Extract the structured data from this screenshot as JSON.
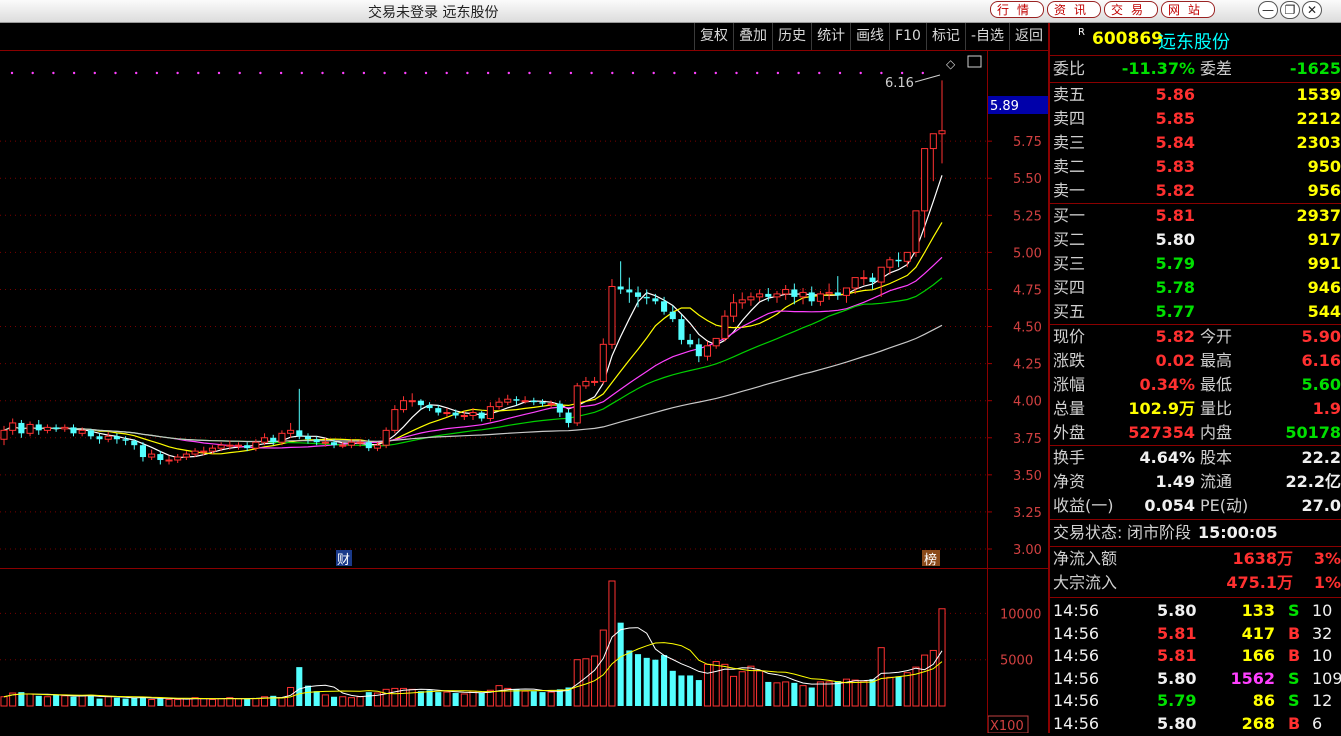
{
  "window": {
    "title": "交易未登录 远东股份",
    "top_buttons": [
      "行情",
      "资讯",
      "交易",
      "网站"
    ],
    "controls": [
      "—",
      "❐",
      "✕"
    ]
  },
  "toolbar": {
    "buttons": [
      "复权",
      "叠加",
      "历史",
      "统计",
      "画线",
      "F10",
      "标记",
      "-自选",
      "返回"
    ]
  },
  "chart": {
    "price_axis": [
      "5.75",
      "5.50",
      "5.25",
      "5.00",
      "4.75",
      "4.50",
      "4.25",
      "4.00",
      "3.75",
      "3.50",
      "3.25",
      "3.00"
    ],
    "current_price_label": "5.89",
    "high_annotation": "6.16",
    "marker_cai": "财",
    "marker_bang": "榜",
    "volume_axis": [
      "10000",
      "5000"
    ],
    "volume_unit": "X100",
    "colors": {
      "up": "#ff3232",
      "down": "#54ffff",
      "ma5": "#ffffff",
      "ma10": "#ffff00",
      "ma20": "#ff40ff",
      "ma30": "#00d000",
      "ma60": "#c8c8c8"
    }
  },
  "chart_data": {
    "type": "candlestick",
    "ylim": [
      3.0,
      6.25
    ],
    "volume_ylim": [
      0,
      13500
    ],
    "x": [
      1,
      2,
      3,
      4,
      5,
      6,
      7,
      8,
      9,
      10,
      11,
      12,
      13,
      14,
      15,
      16,
      17,
      18,
      19,
      20,
      21,
      22,
      23,
      24,
      25,
      26,
      27,
      28,
      29,
      30,
      31,
      32,
      33,
      34,
      35,
      36,
      37,
      38,
      39,
      40,
      41,
      42,
      43,
      44,
      45,
      46,
      47,
      48,
      49,
      50,
      51,
      52,
      53,
      54,
      55,
      56,
      57,
      58,
      59,
      60,
      61,
      62,
      63,
      64,
      65,
      66,
      67,
      68,
      69,
      70,
      71,
      72,
      73,
      74,
      75,
      76,
      77,
      78,
      79,
      80,
      81,
      82,
      83,
      84,
      85,
      86,
      87,
      88,
      89,
      90,
      91,
      92,
      93,
      94,
      95,
      96,
      97,
      98,
      99,
      100,
      101,
      102,
      103,
      104,
      105,
      106,
      107,
      108,
      109,
      110,
      111,
      112,
      113,
      114,
      115,
      116,
      117,
      118,
      119
    ],
    "open": [
      3.74,
      3.8,
      3.85,
      3.78,
      3.84,
      3.8,
      3.82,
      3.81,
      3.82,
      3.78,
      3.8,
      3.76,
      3.74,
      3.76,
      3.74,
      3.73,
      3.7,
      3.62,
      3.64,
      3.6,
      3.6,
      3.62,
      3.64,
      3.66,
      3.66,
      3.68,
      3.7,
      3.7,
      3.7,
      3.68,
      3.72,
      3.75,
      3.72,
      3.78,
      3.8,
      3.76,
      3.74,
      3.72,
      3.72,
      3.7,
      3.7,
      3.72,
      3.72,
      3.68,
      3.7,
      3.8,
      3.94,
      4.0,
      4.0,
      3.97,
      3.95,
      3.92,
      3.92,
      3.9,
      3.9,
      3.92,
      3.88,
      3.96,
      3.99,
      4.01,
      4.0,
      4.0,
      3.99,
      3.98,
      3.98,
      3.92,
      3.85,
      4.1,
      4.13,
      4.13,
      4.38,
      4.77,
      4.75,
      4.73,
      4.7,
      4.69,
      4.67,
      4.6,
      4.55,
      4.41,
      4.38,
      4.3,
      4.37,
      4.42,
      4.57,
      4.66,
      4.68,
      4.7,
      4.72,
      4.7,
      4.72,
      4.75,
      4.7,
      4.73,
      4.67,
      4.72,
      4.73,
      4.71,
      4.76,
      4.83,
      4.83,
      4.8,
      4.9,
      4.95,
      4.94,
      5.0,
      5.28,
      5.7,
      5.8
    ],
    "close": [
      3.8,
      3.85,
      3.78,
      3.84,
      3.8,
      3.82,
      3.81,
      3.82,
      3.78,
      3.8,
      3.76,
      3.74,
      3.76,
      3.74,
      3.73,
      3.7,
      3.62,
      3.64,
      3.6,
      3.6,
      3.62,
      3.64,
      3.66,
      3.66,
      3.68,
      3.7,
      3.7,
      3.7,
      3.68,
      3.72,
      3.75,
      3.72,
      3.78,
      3.8,
      3.76,
      3.74,
      3.72,
      3.72,
      3.7,
      3.7,
      3.72,
      3.72,
      3.68,
      3.7,
      3.8,
      3.94,
      4.0,
      4.0,
      3.97,
      3.95,
      3.92,
      3.92,
      3.9,
      3.9,
      3.92,
      3.88,
      3.96,
      3.99,
      4.01,
      4.0,
      4.0,
      3.99,
      3.98,
      3.98,
      3.92,
      3.85,
      4.1,
      4.13,
      4.13,
      4.38,
      4.77,
      4.75,
      4.73,
      4.7,
      4.69,
      4.67,
      4.6,
      4.55,
      4.41,
      4.38,
      4.3,
      4.37,
      4.42,
      4.57,
      4.66,
      4.68,
      4.7,
      4.72,
      4.7,
      4.72,
      4.75,
      4.7,
      4.73,
      4.67,
      4.72,
      4.73,
      4.71,
      4.76,
      4.83,
      4.83,
      4.8,
      4.9,
      4.95,
      4.94,
      5.0,
      5.28,
      5.7,
      5.8,
      5.82
    ],
    "high": [
      3.83,
      3.88,
      3.87,
      3.86,
      3.87,
      3.84,
      3.84,
      3.84,
      3.84,
      3.82,
      3.81,
      3.78,
      3.79,
      3.78,
      3.76,
      3.74,
      3.72,
      3.67,
      3.66,
      3.63,
      3.64,
      3.66,
      3.68,
      3.69,
      3.7,
      3.72,
      3.73,
      3.72,
      3.72,
      3.74,
      3.78,
      3.77,
      3.8,
      3.85,
      4.08,
      3.78,
      3.76,
      3.75,
      3.74,
      3.72,
      3.74,
      3.74,
      3.74,
      3.72,
      3.82,
      3.97,
      4.03,
      4.05,
      4.01,
      3.99,
      3.97,
      3.95,
      3.94,
      3.93,
      3.95,
      3.93,
      3.99,
      4.02,
      4.04,
      4.03,
      4.03,
      4.02,
      4.01,
      4.0,
      4.0,
      3.94,
      4.12,
      4.16,
      4.16,
      4.42,
      4.82,
      4.94,
      4.83,
      4.77,
      4.75,
      4.72,
      4.7,
      4.64,
      4.58,
      4.45,
      4.42,
      4.4,
      4.41,
      4.61,
      4.72,
      4.73,
      4.73,
      4.75,
      4.76,
      4.74,
      4.78,
      4.79,
      4.76,
      4.77,
      4.74,
      4.79,
      4.84,
      4.75,
      4.81,
      4.88,
      4.86,
      4.86,
      4.97,
      5.0,
      5.0,
      5.08,
      5.33,
      5.8,
      6.16
    ],
    "low": [
      3.7,
      3.77,
      3.75,
      3.76,
      3.77,
      3.78,
      3.79,
      3.79,
      3.76,
      3.76,
      3.74,
      3.71,
      3.72,
      3.71,
      3.7,
      3.67,
      3.59,
      3.6,
      3.57,
      3.57,
      3.58,
      3.6,
      3.62,
      3.63,
      3.64,
      3.66,
      3.67,
      3.67,
      3.66,
      3.66,
      3.7,
      3.7,
      3.7,
      3.75,
      3.74,
      3.71,
      3.7,
      3.69,
      3.68,
      3.68,
      3.68,
      3.69,
      3.66,
      3.66,
      3.68,
      3.78,
      3.92,
      3.96,
      3.94,
      3.93,
      3.9,
      3.89,
      3.88,
      3.87,
      3.87,
      3.86,
      3.86,
      3.94,
      3.97,
      3.97,
      3.98,
      3.97,
      3.96,
      3.95,
      3.89,
      3.82,
      3.83,
      4.08,
      4.1,
      4.11,
      4.35,
      4.72,
      4.66,
      4.63,
      4.65,
      4.65,
      4.58,
      4.53,
      4.38,
      4.36,
      4.26,
      4.27,
      4.35,
      4.4,
      4.53,
      4.62,
      4.64,
      4.67,
      4.67,
      4.66,
      4.68,
      4.65,
      4.65,
      4.64,
      4.64,
      4.68,
      4.68,
      4.66,
      4.72,
      4.78,
      4.75,
      4.7,
      4.85,
      4.9,
      4.9,
      4.97,
      5.1,
      5.48,
      5.6
    ],
    "volume": [
      1000,
      1400,
      1500,
      1300,
      1100,
      1000,
      1200,
      1100,
      1000,
      1100,
      1200,
      800,
      1000,
      900,
      800,
      900,
      1000,
      700,
      800,
      700,
      700,
      800,
      900,
      800,
      700,
      800,
      900,
      800,
      800,
      800,
      1000,
      1100,
      900,
      2000,
      4200,
      2200,
      1600,
      1200,
      1000,
      1000,
      900,
      1000,
      1500,
      1400,
      1800,
      1900,
      1900,
      1800,
      1600,
      1700,
      1500,
      1500,
      1400,
      1300,
      1600,
      1400,
      1700,
      2200,
      1900,
      1800,
      1600,
      1600,
      1500,
      1500,
      1800,
      2000,
      5000,
      5100,
      5400,
      8200,
      13500,
      9000,
      6000,
      5600,
      5200,
      5000,
      5500,
      3800,
      3300,
      3300,
      2800,
      4500,
      4800,
      4500,
      3200,
      3700,
      4300,
      3800,
      2600,
      2500,
      2600,
      2500,
      2200,
      2000,
      2600,
      2600,
      2700,
      2900,
      2800,
      2700,
      2900,
      6300,
      3100,
      3200,
      3600,
      4200,
      5500,
      6000,
      10500
    ],
    "ma_series": [
      "MA5",
      "MA10",
      "MA20",
      "MA30",
      "MA60"
    ]
  },
  "quote": {
    "code": "600869",
    "name": "远东股份",
    "weibi_label": "委比",
    "weibi_value": "-11.37%",
    "weicha_label": "委差",
    "weicha_value": "-1625",
    "sell": [
      {
        "label": "卖五",
        "price": "5.86",
        "vol": "1539"
      },
      {
        "label": "卖四",
        "price": "5.85",
        "vol": "2212"
      },
      {
        "label": "卖三",
        "price": "5.84",
        "vol": "2303"
      },
      {
        "label": "卖二",
        "price": "5.83",
        "vol": "950"
      },
      {
        "label": "卖一",
        "price": "5.82",
        "vol": "956"
      }
    ],
    "buy": [
      {
        "label": "买一",
        "price": "5.81",
        "vol": "2937"
      },
      {
        "label": "买二",
        "price": "5.80",
        "vol": "917"
      },
      {
        "label": "买三",
        "price": "5.79",
        "vol": "991"
      },
      {
        "label": "买四",
        "price": "5.78",
        "vol": "946"
      },
      {
        "label": "买五",
        "price": "5.77",
        "vol": "544"
      }
    ],
    "stats": [
      {
        "l1": "现价",
        "v1": "5.82",
        "l2": "今开",
        "v2": "5.90"
      },
      {
        "l1": "涨跌",
        "v1": "0.02",
        "l2": "最高",
        "v2": "6.16"
      },
      {
        "l1": "涨幅",
        "v1": "0.34%",
        "l2": "最低",
        "v2": "5.60"
      },
      {
        "l1": "总量",
        "v1": "102.9万",
        "l2": "量比",
        "v2": "1.9"
      },
      {
        "l1": "外盘",
        "v1": "527354",
        "l2": "内盘",
        "v2": "50178"
      }
    ],
    "stats2": [
      {
        "l1": "换手",
        "v1": "4.64%",
        "l2": "股本",
        "v2": "22.2"
      },
      {
        "l1": "净资",
        "v1": "1.49",
        "l2": "流通",
        "v2": "22.2亿"
      },
      {
        "l1": "收益(一)",
        "v1": "0.054",
        "l2": "PE(动)",
        "v2": "27.0"
      }
    ],
    "state_label": "交易状态:",
    "state_value": "闭市阶段",
    "state_time": "15:00:05",
    "flow": [
      {
        "label": "净流入额",
        "value": "1638万",
        "pct": "3%"
      },
      {
        "label": "大宗流入",
        "value": "475.1万",
        "pct": "1%"
      }
    ],
    "ticks": [
      {
        "time": "14:56",
        "price": "5.80",
        "vol": "133",
        "side": "S",
        "num": "10"
      },
      {
        "time": "14:56",
        "price": "5.81",
        "vol": "417",
        "side": "B",
        "num": "32"
      },
      {
        "time": "14:56",
        "price": "5.81",
        "vol": "166",
        "side": "B",
        "num": "10"
      },
      {
        "time": "14:56",
        "price": "5.80",
        "vol": "1562",
        "side": "S",
        "num": "109"
      },
      {
        "time": "14:56",
        "price": "5.79",
        "vol": "86",
        "side": "S",
        "num": "12"
      },
      {
        "time": "14:56",
        "price": "5.80",
        "vol": "268",
        "side": "B",
        "num": "6"
      }
    ]
  }
}
